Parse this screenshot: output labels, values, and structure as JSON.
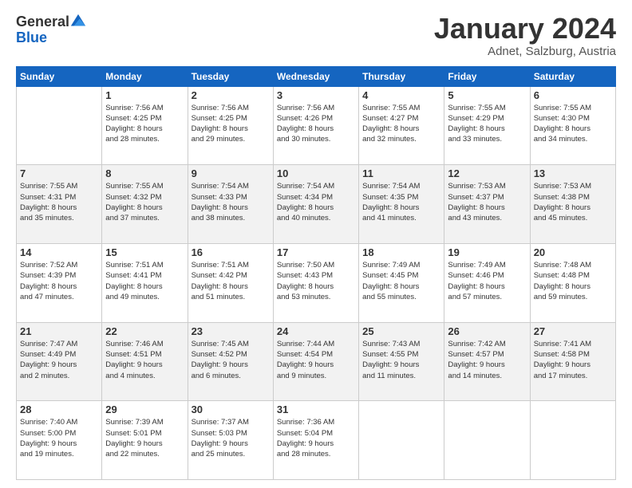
{
  "header": {
    "logo_general": "General",
    "logo_blue": "Blue",
    "month_title": "January 2024",
    "location": "Adnet, Salzburg, Austria"
  },
  "weekdays": [
    "Sunday",
    "Monday",
    "Tuesday",
    "Wednesday",
    "Thursday",
    "Friday",
    "Saturday"
  ],
  "weeks": [
    [
      {
        "day": "",
        "sunrise": "",
        "sunset": "",
        "daylight": ""
      },
      {
        "day": "1",
        "sunrise": "Sunrise: 7:56 AM",
        "sunset": "Sunset: 4:25 PM",
        "daylight": "Daylight: 8 hours and 28 minutes."
      },
      {
        "day": "2",
        "sunrise": "Sunrise: 7:56 AM",
        "sunset": "Sunset: 4:25 PM",
        "daylight": "Daylight: 8 hours and 29 minutes."
      },
      {
        "day": "3",
        "sunrise": "Sunrise: 7:56 AM",
        "sunset": "Sunset: 4:26 PM",
        "daylight": "Daylight: 8 hours and 30 minutes."
      },
      {
        "day": "4",
        "sunrise": "Sunrise: 7:55 AM",
        "sunset": "Sunset: 4:27 PM",
        "daylight": "Daylight: 8 hours and 32 minutes."
      },
      {
        "day": "5",
        "sunrise": "Sunrise: 7:55 AM",
        "sunset": "Sunset: 4:29 PM",
        "daylight": "Daylight: 8 hours and 33 minutes."
      },
      {
        "day": "6",
        "sunrise": "Sunrise: 7:55 AM",
        "sunset": "Sunset: 4:30 PM",
        "daylight": "Daylight: 8 hours and 34 minutes."
      }
    ],
    [
      {
        "day": "7",
        "sunrise": "Sunrise: 7:55 AM",
        "sunset": "Sunset: 4:31 PM",
        "daylight": "Daylight: 8 hours and 35 minutes."
      },
      {
        "day": "8",
        "sunrise": "Sunrise: 7:55 AM",
        "sunset": "Sunset: 4:32 PM",
        "daylight": "Daylight: 8 hours and 37 minutes."
      },
      {
        "day": "9",
        "sunrise": "Sunrise: 7:54 AM",
        "sunset": "Sunset: 4:33 PM",
        "daylight": "Daylight: 8 hours and 38 minutes."
      },
      {
        "day": "10",
        "sunrise": "Sunrise: 7:54 AM",
        "sunset": "Sunset: 4:34 PM",
        "daylight": "Daylight: 8 hours and 40 minutes."
      },
      {
        "day": "11",
        "sunrise": "Sunrise: 7:54 AM",
        "sunset": "Sunset: 4:35 PM",
        "daylight": "Daylight: 8 hours and 41 minutes."
      },
      {
        "day": "12",
        "sunrise": "Sunrise: 7:53 AM",
        "sunset": "Sunset: 4:37 PM",
        "daylight": "Daylight: 8 hours and 43 minutes."
      },
      {
        "day": "13",
        "sunrise": "Sunrise: 7:53 AM",
        "sunset": "Sunset: 4:38 PM",
        "daylight": "Daylight: 8 hours and 45 minutes."
      }
    ],
    [
      {
        "day": "14",
        "sunrise": "Sunrise: 7:52 AM",
        "sunset": "Sunset: 4:39 PM",
        "daylight": "Daylight: 8 hours and 47 minutes."
      },
      {
        "day": "15",
        "sunrise": "Sunrise: 7:51 AM",
        "sunset": "Sunset: 4:41 PM",
        "daylight": "Daylight: 8 hours and 49 minutes."
      },
      {
        "day": "16",
        "sunrise": "Sunrise: 7:51 AM",
        "sunset": "Sunset: 4:42 PM",
        "daylight": "Daylight: 8 hours and 51 minutes."
      },
      {
        "day": "17",
        "sunrise": "Sunrise: 7:50 AM",
        "sunset": "Sunset: 4:43 PM",
        "daylight": "Daylight: 8 hours and 53 minutes."
      },
      {
        "day": "18",
        "sunrise": "Sunrise: 7:49 AM",
        "sunset": "Sunset: 4:45 PM",
        "daylight": "Daylight: 8 hours and 55 minutes."
      },
      {
        "day": "19",
        "sunrise": "Sunrise: 7:49 AM",
        "sunset": "Sunset: 4:46 PM",
        "daylight": "Daylight: 8 hours and 57 minutes."
      },
      {
        "day": "20",
        "sunrise": "Sunrise: 7:48 AM",
        "sunset": "Sunset: 4:48 PM",
        "daylight": "Daylight: 8 hours and 59 minutes."
      }
    ],
    [
      {
        "day": "21",
        "sunrise": "Sunrise: 7:47 AM",
        "sunset": "Sunset: 4:49 PM",
        "daylight": "Daylight: 9 hours and 2 minutes."
      },
      {
        "day": "22",
        "sunrise": "Sunrise: 7:46 AM",
        "sunset": "Sunset: 4:51 PM",
        "daylight": "Daylight: 9 hours and 4 minutes."
      },
      {
        "day": "23",
        "sunrise": "Sunrise: 7:45 AM",
        "sunset": "Sunset: 4:52 PM",
        "daylight": "Daylight: 9 hours and 6 minutes."
      },
      {
        "day": "24",
        "sunrise": "Sunrise: 7:44 AM",
        "sunset": "Sunset: 4:54 PM",
        "daylight": "Daylight: 9 hours and 9 minutes."
      },
      {
        "day": "25",
        "sunrise": "Sunrise: 7:43 AM",
        "sunset": "Sunset: 4:55 PM",
        "daylight": "Daylight: 9 hours and 11 minutes."
      },
      {
        "day": "26",
        "sunrise": "Sunrise: 7:42 AM",
        "sunset": "Sunset: 4:57 PM",
        "daylight": "Daylight: 9 hours and 14 minutes."
      },
      {
        "day": "27",
        "sunrise": "Sunrise: 7:41 AM",
        "sunset": "Sunset: 4:58 PM",
        "daylight": "Daylight: 9 hours and 17 minutes."
      }
    ],
    [
      {
        "day": "28",
        "sunrise": "Sunrise: 7:40 AM",
        "sunset": "Sunset: 5:00 PM",
        "daylight": "Daylight: 9 hours and 19 minutes."
      },
      {
        "day": "29",
        "sunrise": "Sunrise: 7:39 AM",
        "sunset": "Sunset: 5:01 PM",
        "daylight": "Daylight: 9 hours and 22 minutes."
      },
      {
        "day": "30",
        "sunrise": "Sunrise: 7:37 AM",
        "sunset": "Sunset: 5:03 PM",
        "daylight": "Daylight: 9 hours and 25 minutes."
      },
      {
        "day": "31",
        "sunrise": "Sunrise: 7:36 AM",
        "sunset": "Sunset: 5:04 PM",
        "daylight": "Daylight: 9 hours and 28 minutes."
      },
      {
        "day": "",
        "sunrise": "",
        "sunset": "",
        "daylight": ""
      },
      {
        "day": "",
        "sunrise": "",
        "sunset": "",
        "daylight": ""
      },
      {
        "day": "",
        "sunrise": "",
        "sunset": "",
        "daylight": ""
      }
    ]
  ]
}
